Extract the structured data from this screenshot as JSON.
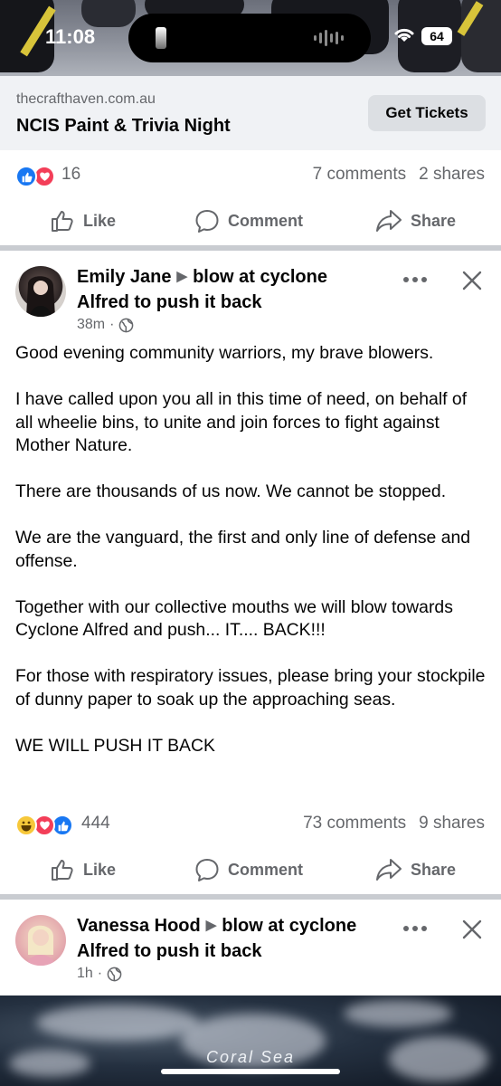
{
  "status_bar": {
    "time": "11:08",
    "battery": "64"
  },
  "ad": {
    "domain": "thecrafthaven.com.au",
    "title": "NCIS Paint & Trivia Night",
    "cta": "Get Tickets",
    "reaction_count": "16",
    "comments": "7 comments",
    "shares": "2 shares"
  },
  "actions": {
    "like": "Like",
    "comment": "Comment",
    "share": "Share"
  },
  "post1": {
    "author": "Emily Jane",
    "group_part1": "blow at cyclone",
    "group_part2": "Alfred to push it back",
    "time": "38m",
    "paragraphs": [
      "Good evening community warriors, my brave blowers.",
      "I have called upon you all in this time of need, on behalf of all wheelie bins, to unite and join forces to fight against Mother Nature.",
      "There are thousands of us now. We cannot be stopped.",
      "We are the vanguard, the first and only line of defense and offense.",
      "Together with our collective mouths we will blow towards Cyclone Alfred and push... IT.... BACK!!!",
      "For those with respiratory issues, please bring your stockpile of dunny paper to soak up the approaching seas.",
      "WE WILL PUSH IT BACK"
    ],
    "reaction_count": "444",
    "comments": "73 comments",
    "shares": "9 shares"
  },
  "post2": {
    "author": "Vanessa Hood",
    "group_part1": "blow at cyclone",
    "group_part2": "Alfred to push it back",
    "time": "1h",
    "image_label": "Coral Sea"
  },
  "icons": {
    "like": "thumbs-up-icon",
    "comment": "speech-bubble-icon",
    "share": "share-arrow-icon",
    "more": "more-dots-icon",
    "close": "close-x-icon",
    "audience": "globe-icon"
  },
  "colors": {
    "like_blue": "#1877f2",
    "love_red": "#f33e58",
    "haha_yellow": "#f7c83a",
    "secondary_text": "#65676b",
    "divider": "#c9ccd1"
  }
}
